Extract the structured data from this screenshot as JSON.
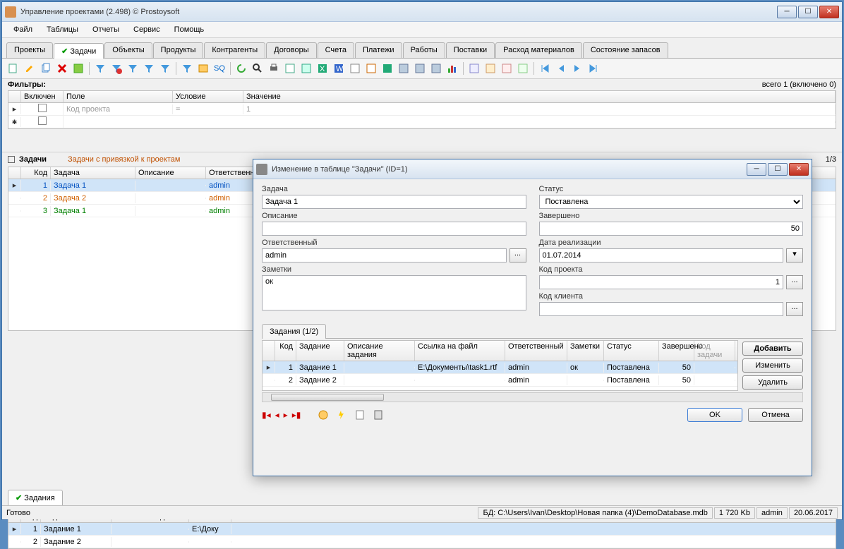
{
  "main": {
    "title": "Управление проектами (2.498) © Prostoysoft",
    "menus": [
      "Файл",
      "Таблицы",
      "Отчеты",
      "Сервис",
      "Помощь"
    ],
    "tabs": [
      "Проекты",
      "Задачи",
      "Объекты",
      "Продукты",
      "Контрагенты",
      "Договоры",
      "Счета",
      "Платежи",
      "Работы",
      "Поставки",
      "Расход материалов",
      "Состояние запасов"
    ],
    "active_tab": 1,
    "filters_label": "Фильтры:",
    "filters_summary": "всего 1 (включено 0)",
    "filter_headers": [
      "Включен",
      "Поле",
      "Условие",
      "Значение"
    ],
    "filter_row": {
      "field": "Код проекта",
      "cond": "=",
      "value": "1"
    },
    "tasks_section": "Задачи",
    "tasks_link": "Задачи с привязкой к проектам",
    "tasks_pager": "1/3",
    "tasks_headers": [
      "Код",
      "Задача",
      "Описание",
      "Ответственный"
    ],
    "tasks": [
      {
        "id": "1",
        "name": "Задача 1",
        "desc": "",
        "resp": "admin",
        "cls": "c-blue",
        "sel": true
      },
      {
        "id": "2",
        "name": "Задача 2",
        "desc": "",
        "resp": "admin",
        "cls": "c-orange"
      },
      {
        "id": "3",
        "name": "Задача 1",
        "desc": "",
        "resp": "admin",
        "cls": "c-green"
      }
    ],
    "assignments_tab": "Задания",
    "assignments_headers": [
      "Код",
      "Задание",
      "Описание задания",
      "Ссылка"
    ],
    "assignments": [
      {
        "id": "1",
        "name": "Задание 1",
        "desc": "",
        "link": "E:\\Доку",
        "sel": true
      },
      {
        "id": "2",
        "name": "Задание 2",
        "desc": "",
        "link": ""
      }
    ],
    "status_left": "Готово",
    "status_db_label": "БД:",
    "status_db": "C:\\Users\\Ivan\\Desktop\\Новая папка (4)\\DemoDatabase.mdb",
    "status_size": "1 720 Kb",
    "status_user": "admin",
    "status_date": "20.06.2017"
  },
  "dialog": {
    "title": "Изменение в таблице \"Задачи\" (ID=1)",
    "labels": {
      "task": "Задача",
      "status": "Статус",
      "desc": "Описание",
      "done": "Завершено",
      "resp": "Ответственный",
      "date": "Дата реализации",
      "notes": "Заметки",
      "proj": "Код проекта",
      "client": "Код клиента"
    },
    "values": {
      "task": "Задача 1",
      "status": "Поставлена",
      "desc": "",
      "done": "50",
      "resp": "admin",
      "date": "01.07.2014",
      "notes": "ок",
      "proj": "1",
      "client": ""
    },
    "subtab": "Задания (1/2)",
    "grid_headers": [
      "Код",
      "Задание",
      "Описание задания",
      "Ссылка на файл",
      "Ответственный",
      "Заметки",
      "Статус",
      "Завершено",
      "Код задачи"
    ],
    "grid_rows": [
      {
        "id": "1",
        "name": "Задание 1",
        "desc": "",
        "link": "E:\\Документы\\task1.rtf",
        "resp": "admin",
        "notes": "ок",
        "status": "Поставлена",
        "done": "50",
        "sel": true
      },
      {
        "id": "2",
        "name": "Задание 2",
        "desc": "",
        "link": "",
        "resp": "admin",
        "notes": "",
        "status": "Поставлена",
        "done": "50"
      }
    ],
    "btn_add": "Добавить",
    "btn_edit": "Изменить",
    "btn_del": "Удалить",
    "btn_ok": "OK",
    "btn_cancel": "Отмена"
  }
}
